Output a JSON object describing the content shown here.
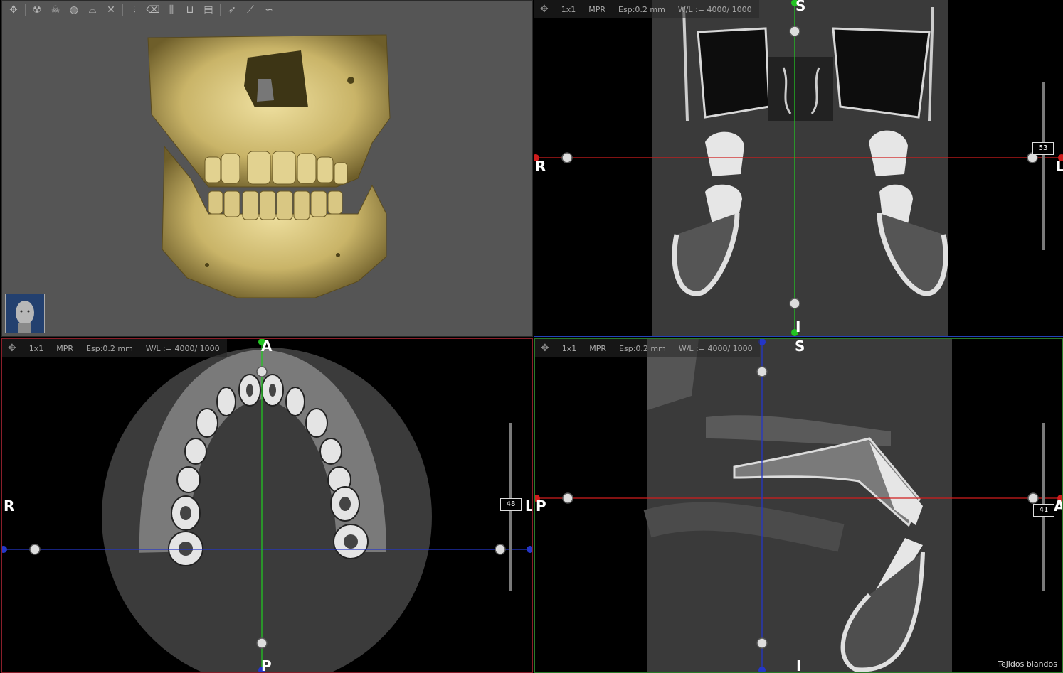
{
  "toolbar": {
    "icons": [
      "move-icon",
      "radiation-icon",
      "skull-icon",
      "sphere-icon",
      "tooth-icon",
      "close-icon",
      "implant-icon",
      "eraser-icon",
      "teeth-icon",
      "panoramic-icon",
      "gallery-icon",
      "nerve-icon",
      "measure-icon",
      "curve-icon"
    ]
  },
  "viewports": {
    "coronal": {
      "layout": "1x1",
      "mode": "MPR",
      "spacing": "Esp:0.2 mm",
      "wl": "W/L := 4000/ 1000",
      "orient_top": "S",
      "orient_bottom": "I",
      "orient_left": "R",
      "orient_right": "L",
      "slice": "53"
    },
    "axial": {
      "layout": "1x1",
      "mode": "MPR",
      "spacing": "Esp:0.2 mm",
      "wl": "W/L := 4000/ 1000",
      "orient_top": "A",
      "orient_bottom": "P",
      "orient_left": "R",
      "orient_right": "L",
      "slice": "48"
    },
    "sagittal": {
      "layout": "1x1",
      "mode": "MPR",
      "spacing": "Esp:0.2 mm",
      "wl": "W/L := 4000/ 1000",
      "orient_top": "S",
      "orient_bottom": "I",
      "orient_left": "P",
      "orient_right": "A",
      "slice": "41",
      "preset": "Tejidos blandos"
    }
  },
  "colors": {
    "crosshair_red": "#d01c1c",
    "crosshair_green": "#22c422",
    "crosshair_blue": "#2436c8",
    "bone": "#c8b56a"
  }
}
